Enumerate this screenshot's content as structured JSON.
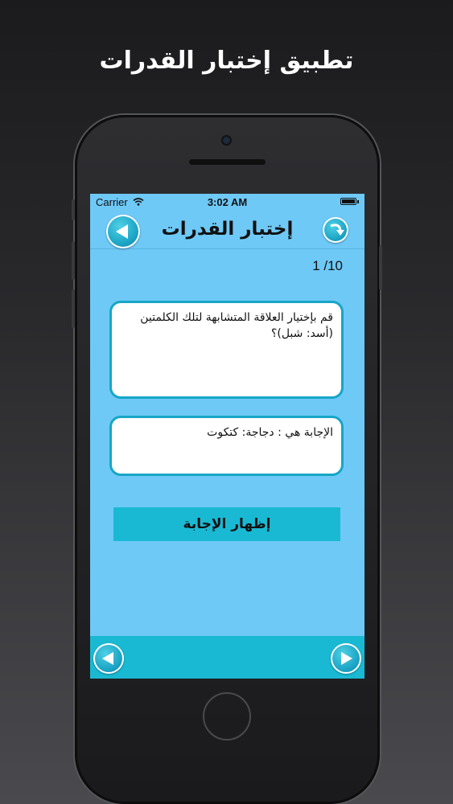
{
  "promo": {
    "title": "تطبيق إختبار القدرات"
  },
  "status_bar": {
    "carrier": "Carrier",
    "time": "3:02 AM"
  },
  "navbar": {
    "title": "إختبار القدرات",
    "back_icon": "back-arrow-icon",
    "share_icon": "curved-arrow-icon"
  },
  "quiz": {
    "counter": "1 /10",
    "question": "قم بإختيار العلاقة المتشابهة لتلك الكلمتين (أسد: شبل)؟",
    "answer": "الإجابة هي : دجاجة: كتكوت",
    "show_answer_label": "إظهار الإجابة"
  },
  "bottom_bar": {
    "prev_icon": "left-arrow-icon",
    "next_icon": "right-arrow-icon"
  },
  "colors": {
    "screen_bg": "#6ec9f7",
    "accent": "#1ab9d3",
    "box_border": "#17a6c6"
  }
}
